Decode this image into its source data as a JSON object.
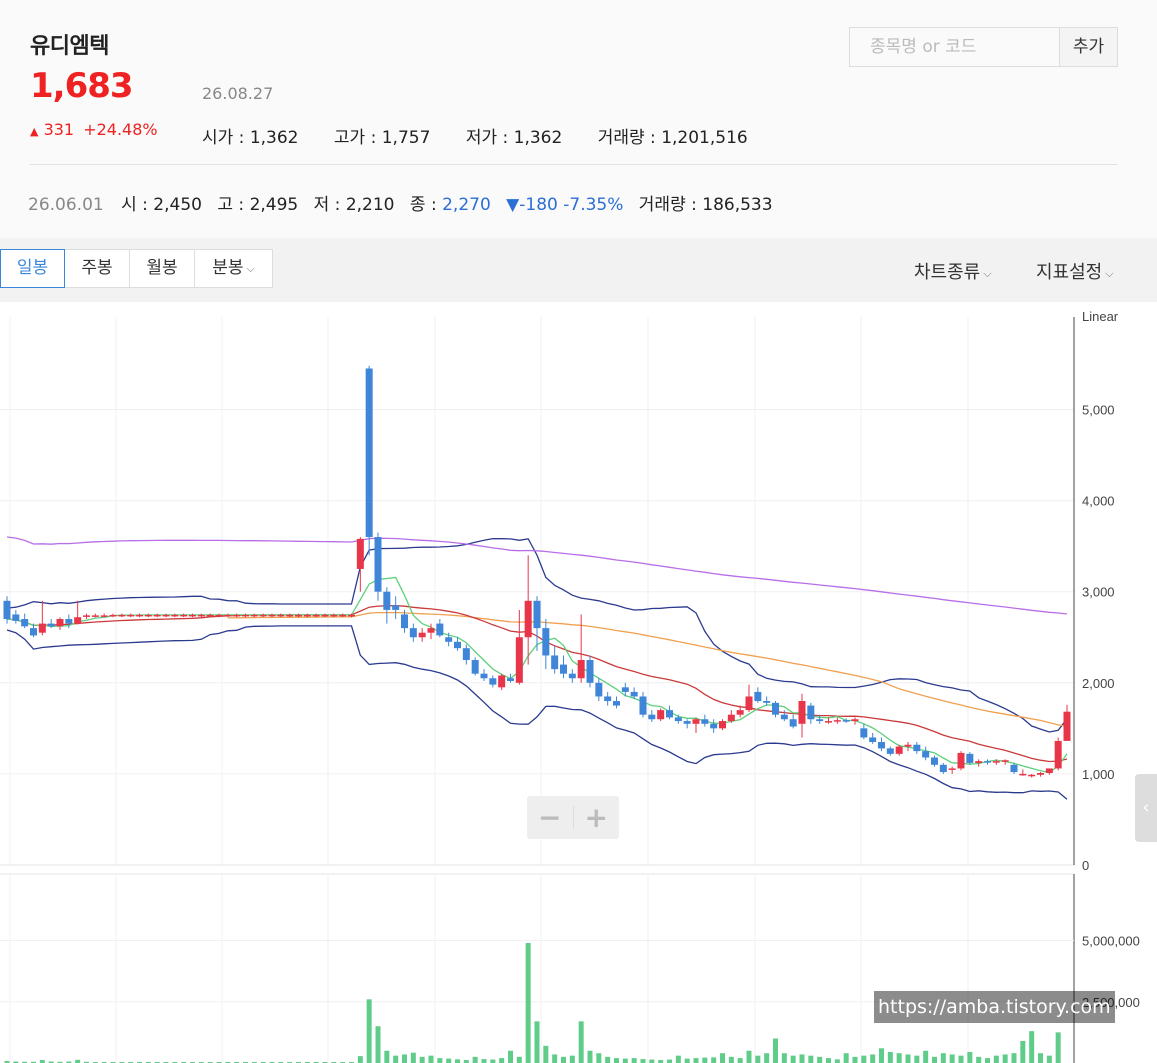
{
  "stock": {
    "name": "유디엠텍",
    "price": "1,683",
    "change_arrow": "▲",
    "change_value": "331",
    "change_pct": "+24.48%",
    "date": "26.08.27",
    "open_label": "시가",
    "open": "1,362",
    "high_label": "고가",
    "high": "1,757",
    "low_label": "저가",
    "low": "1,362",
    "volume_label": "거래량",
    "volume": "1,201,516"
  },
  "previous": {
    "date": "26.06.01",
    "open_label": "시",
    "open": "2,450",
    "high_label": "고",
    "high": "2,495",
    "low_label": "저",
    "low": "2,210",
    "close_label": "종",
    "close": "2,270",
    "change_arrow": "▼",
    "change_value": "-180",
    "change_pct": "-7.35%",
    "volume_label": "거래량",
    "volume": "186,533"
  },
  "search": {
    "placeholder": "종목명 or 코드",
    "add_label": "추가"
  },
  "periods": [
    {
      "label": "일봉",
      "active": true
    },
    {
      "label": "주봉",
      "active": false
    },
    {
      "label": "월봉",
      "active": false
    },
    {
      "label": "분봉",
      "active": false
    }
  ],
  "tools": {
    "chart_type": "차트종류",
    "indicator": "지표설정"
  },
  "zoom": {
    "minus": "−",
    "plus": "+"
  },
  "watermark": "https://amba.tistory.com",
  "colors": {
    "up": "#e8354a",
    "down": "#3f86d8",
    "volume": "#5fcc8a",
    "price_red": "#e22222",
    "blue": "#2a6fd6"
  },
  "chart_data": {
    "type": "candlestick",
    "scale": "Linear",
    "ylim": [
      0,
      6000
    ],
    "y_ticks": [
      "0",
      "1,000",
      "2,000",
      "3,000",
      "4,000",
      "5,000"
    ],
    "volume_ylim": [
      0,
      7000000
    ],
    "volume_ticks": [
      "2,500,000",
      "5,000,000"
    ],
    "candles": [
      [
        2900,
        2950,
        2650,
        2700
      ],
      [
        2750,
        2800,
        2650,
        2680
      ],
      [
        2700,
        2760,
        2600,
        2620
      ],
      [
        2600,
        2650,
        2500,
        2520
      ],
      [
        2550,
        2900,
        2520,
        2650
      ],
      [
        2650,
        2700,
        2600,
        2620
      ],
      [
        2620,
        2720,
        2580,
        2700
      ],
      [
        2700,
        2750,
        2600,
        2650
      ],
      [
        2650,
        2900,
        2640,
        2720
      ],
      [
        2730,
        2760,
        2700,
        2740
      ],
      [
        2740,
        2760,
        2720,
        2740
      ],
      [
        2740,
        2760,
        2720,
        2740
      ],
      [
        2740,
        2760,
        2720,
        2745
      ],
      [
        2745,
        2760,
        2720,
        2745
      ],
      [
        2745,
        2760,
        2720,
        2745
      ],
      [
        2745,
        2760,
        2720,
        2745
      ],
      [
        2745,
        2760,
        2720,
        2745
      ],
      [
        2745,
        2760,
        2720,
        2745
      ],
      [
        2745,
        2760,
        2720,
        2745
      ],
      [
        2745,
        2760,
        2720,
        2745
      ],
      [
        2745,
        2760,
        2720,
        2745
      ],
      [
        2745,
        2760,
        2720,
        2745
      ],
      [
        2745,
        2760,
        2720,
        2745
      ],
      [
        2745,
        2760,
        2720,
        2745
      ],
      [
        2745,
        2760,
        2720,
        2745
      ],
      [
        2745,
        2760,
        2720,
        2745
      ],
      [
        2745,
        2760,
        2720,
        2745
      ],
      [
        2745,
        2760,
        2720,
        2745
      ],
      [
        2745,
        2760,
        2720,
        2745
      ],
      [
        2745,
        2760,
        2720,
        2745
      ],
      [
        2745,
        2760,
        2720,
        2745
      ],
      [
        2745,
        2760,
        2720,
        2745
      ],
      [
        2745,
        2760,
        2720,
        2745
      ],
      [
        2745,
        2760,
        2720,
        2745
      ],
      [
        2745,
        2760,
        2720,
        2745
      ],
      [
        2745,
        2760,
        2720,
        2745
      ],
      [
        2745,
        2760,
        2720,
        2745
      ],
      [
        2745,
        2760,
        2720,
        2745
      ],
      [
        2745,
        2760,
        2720,
        2745
      ],
      [
        2745,
        2760,
        2720,
        2745
      ],
      [
        3250,
        3600,
        3000,
        3580
      ],
      [
        5450,
        5480,
        3400,
        3600
      ],
      [
        3600,
        3650,
        2900,
        3000
      ],
      [
        3000,
        3050,
        2650,
        2800
      ],
      [
        2850,
        2950,
        2700,
        2800
      ],
      [
        2750,
        2800,
        2550,
        2600
      ],
      [
        2600,
        2650,
        2450,
        2500
      ],
      [
        2500,
        2600,
        2450,
        2550
      ],
      [
        2550,
        2650,
        2480,
        2600
      ],
      [
        2650,
        2700,
        2500,
        2520
      ],
      [
        2500,
        2550,
        2400,
        2450
      ],
      [
        2450,
        2500,
        2350,
        2380
      ],
      [
        2380,
        2420,
        2200,
        2250
      ],
      [
        2250,
        2280,
        2080,
        2100
      ],
      [
        2100,
        2150,
        2020,
        2050
      ],
      [
        2050,
        2080,
        1950,
        1980
      ],
      [
        1950,
        2100,
        1920,
        2080
      ],
      [
        2050,
        2100,
        2000,
        2020
      ],
      [
        2000,
        2800,
        1980,
        2500
      ],
      [
        2500,
        3400,
        2200,
        2900
      ],
      [
        2900,
        2950,
        2350,
        2600
      ],
      [
        2600,
        2700,
        2150,
        2300
      ],
      [
        2300,
        2400,
        2100,
        2150
      ],
      [
        2200,
        2300,
        2050,
        2100
      ],
      [
        2100,
        2150,
        2000,
        2050
      ],
      [
        2050,
        2750,
        2000,
        2250
      ],
      [
        2250,
        2300,
        1950,
        2000
      ],
      [
        2000,
        2050,
        1800,
        1850
      ],
      [
        1850,
        1900,
        1750,
        1800
      ],
      [
        1800,
        1850,
        1720,
        1750
      ],
      [
        1950,
        2000,
        1850,
        1900
      ],
      [
        1900,
        1950,
        1820,
        1850
      ],
      [
        1850,
        1900,
        1620,
        1650
      ],
      [
        1650,
        1700,
        1570,
        1600
      ],
      [
        1600,
        1720,
        1580,
        1700
      ],
      [
        1700,
        1750,
        1600,
        1620
      ],
      [
        1620,
        1650,
        1550,
        1580
      ],
      [
        1580,
        1600,
        1500,
        1550
      ],
      [
        1550,
        1620,
        1450,
        1600
      ],
      [
        1600,
        1650,
        1520,
        1550
      ],
      [
        1550,
        1600,
        1450,
        1500
      ],
      [
        1500,
        1600,
        1480,
        1580
      ],
      [
        1580,
        1700,
        1560,
        1650
      ],
      [
        1650,
        1750,
        1620,
        1700
      ],
      [
        1700,
        1980,
        1680,
        1850
      ],
      [
        1900,
        1950,
        1780,
        1800
      ],
      [
        1800,
        1850,
        1750,
        1780
      ],
      [
        1780,
        1800,
        1620,
        1650
      ],
      [
        1650,
        1700,
        1580,
        1600
      ],
      [
        1600,
        1650,
        1500,
        1520
      ],
      [
        1550,
        1880,
        1400,
        1800
      ],
      [
        1750,
        1780,
        1550,
        1600
      ],
      [
        1600,
        1650,
        1550,
        1580
      ],
      [
        1580,
        1620,
        1550,
        1580
      ],
      [
        1580,
        1620,
        1550,
        1590
      ],
      [
        1590,
        1610,
        1560,
        1580
      ],
      [
        1580,
        1620,
        1540,
        1600
      ],
      [
        1500,
        1550,
        1380,
        1400
      ],
      [
        1400,
        1450,
        1330,
        1350
      ],
      [
        1350,
        1400,
        1250,
        1280
      ],
      [
        1280,
        1300,
        1200,
        1220
      ],
      [
        1220,
        1320,
        1200,
        1300
      ],
      [
        1300,
        1350,
        1250,
        1320
      ],
      [
        1320,
        1350,
        1220,
        1250
      ],
      [
        1250,
        1300,
        1150,
        1180
      ],
      [
        1180,
        1200,
        1080,
        1100
      ],
      [
        1100,
        1120,
        1000,
        1020
      ],
      [
        1050,
        1080,
        1000,
        1060
      ],
      [
        1060,
        1250,
        1040,
        1230
      ],
      [
        1220,
        1240,
        1100,
        1120
      ],
      [
        1120,
        1160,
        1080,
        1140
      ],
      [
        1140,
        1160,
        1100,
        1130
      ],
      [
        1130,
        1160,
        1100,
        1140
      ],
      [
        1140,
        1160,
        1100,
        1150
      ],
      [
        1100,
        1120,
        1000,
        1020
      ],
      [
        1000,
        1050,
        980,
        1000
      ],
      [
        980,
        1000,
        960,
        990
      ],
      [
        990,
        1020,
        970,
        1010
      ],
      [
        1010,
        1050,
        990,
        1060
      ],
      [
        1060,
        1400,
        1040,
        1362
      ],
      [
        1362,
        1757,
        1362,
        1683
      ]
    ],
    "volumes": [
      80000,
      60000,
      50000,
      50000,
      120000,
      60000,
      50000,
      60000,
      130000,
      50000,
      40000,
      40000,
      40000,
      40000,
      40000,
      40000,
      40000,
      40000,
      40000,
      40000,
      40000,
      40000,
      40000,
      40000,
      40000,
      40000,
      40000,
      40000,
      40000,
      40000,
      40000,
      40000,
      40000,
      40000,
      40000,
      40000,
      40000,
      40000,
      40000,
      40000,
      280000,
      2600000,
      1500000,
      500000,
      300000,
      350000,
      420000,
      250000,
      300000,
      200000,
      180000,
      150000,
      120000,
      250000,
      160000,
      140000,
      200000,
      500000,
      250000,
      4900000,
      1700000,
      700000,
      350000,
      250000,
      300000,
      1700000,
      500000,
      400000,
      250000,
      200000,
      180000,
      200000,
      160000,
      140000,
      120000,
      140000,
      300000,
      180000,
      200000,
      220000,
      230000,
      400000,
      250000,
      200000,
      500000,
      300000,
      400000,
      1000000,
      400000,
      300000,
      350000,
      300000,
      250000,
      200000,
      150000,
      400000,
      250000,
      300000,
      350000,
      600000,
      450000,
      400000,
      350000,
      300000,
      500000,
      250000,
      400000,
      350000,
      300000,
      450000,
      250000,
      200000,
      300000,
      350000,
      400000,
      900000,
      1300000,
      400000,
      300000,
      1250000
    ]
  }
}
